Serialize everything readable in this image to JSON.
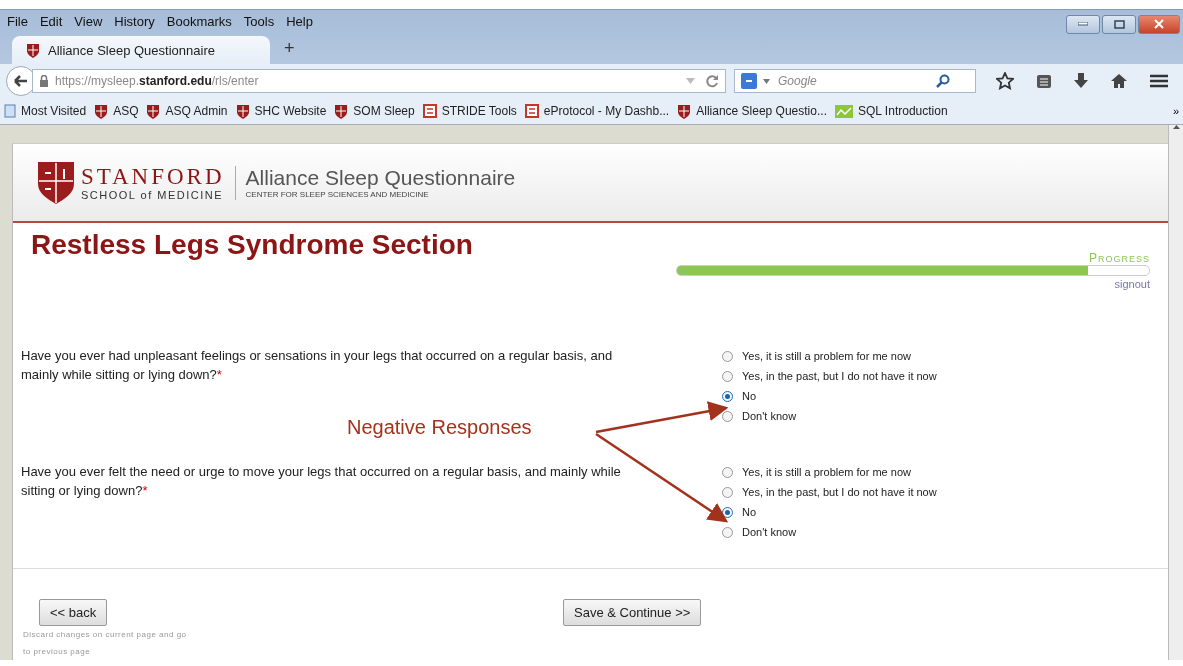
{
  "window": {
    "menu": [
      "File",
      "Edit",
      "View",
      "History",
      "Bookmarks",
      "Tools",
      "Help"
    ],
    "tabs": [
      {
        "title": "Alliance Sleep Questionnaire",
        "selected": true
      }
    ],
    "new_tab": "+",
    "address": "https://mysleep.**stanford.edu**/rls/enter",
    "search": {
      "placeholder": "Google"
    },
    "bookmarks": [
      {
        "label": "Most Visited",
        "kind": "folder"
      },
      {
        "label": "ASQ",
        "kind": "site"
      },
      {
        "label": "ASQ Admin",
        "kind": "site"
      },
      {
        "label": "SHC Website",
        "kind": "site"
      },
      {
        "label": "SOM Sleep",
        "kind": "site"
      },
      {
        "label": "STRIDE Tools",
        "kind": "tool"
      },
      {
        "label": "eProtocol - My Dashb...",
        "kind": "tool"
      },
      {
        "label": "Alliance Sleep Questio...",
        "kind": "site"
      },
      {
        "label": "SQL Introduction",
        "kind": "tutorial"
      }
    ],
    "bookmarks_overflow": "»"
  },
  "page": {
    "brand": {
      "name": "STANFORD",
      "school": "SCHOOL of MEDICINE",
      "app": "Alliance Sleep Questionnaire",
      "center": "CENTER FOR SLEEP SCIENCES AND MEDICINE"
    },
    "section_title": "Restless Legs Syndrome Section",
    "progress": {
      "label": "PROGRESS",
      "level": 0.87
    },
    "signout": "signout",
    "questions": [
      {
        "text": "Have you ever had unpleasant feelings or sensations in your legs that occurred on a regular basis, and mainly while sitting or lying down?",
        "required_mark": "*",
        "options": [
          {
            "label": "Yes, it is still a problem for me now",
            "selected": false
          },
          {
            "label": "Yes, in the past, but I do not have it now",
            "selected": false
          },
          {
            "label": "No",
            "selected": true
          },
          {
            "label": "Don't know",
            "selected": false
          }
        ]
      },
      {
        "text": "Have you ever felt the need or urge to move your legs that occurred on a regular basis, and mainly while sitting or lying down?",
        "required_mark": "*",
        "options": [
          {
            "label": "Yes, it is still a problem for me now",
            "selected": false
          },
          {
            "label": "Yes, in the past, but I do not have it now",
            "selected": false
          },
          {
            "label": "No",
            "selected": true
          },
          {
            "label": "Don't know",
            "selected": false
          }
        ]
      }
    ],
    "annotation": "Negative Responses",
    "back_button": "<< back",
    "back_hint": "Discard changes on current page and go to previous page",
    "continue_button": "Save & Continue >>"
  }
}
